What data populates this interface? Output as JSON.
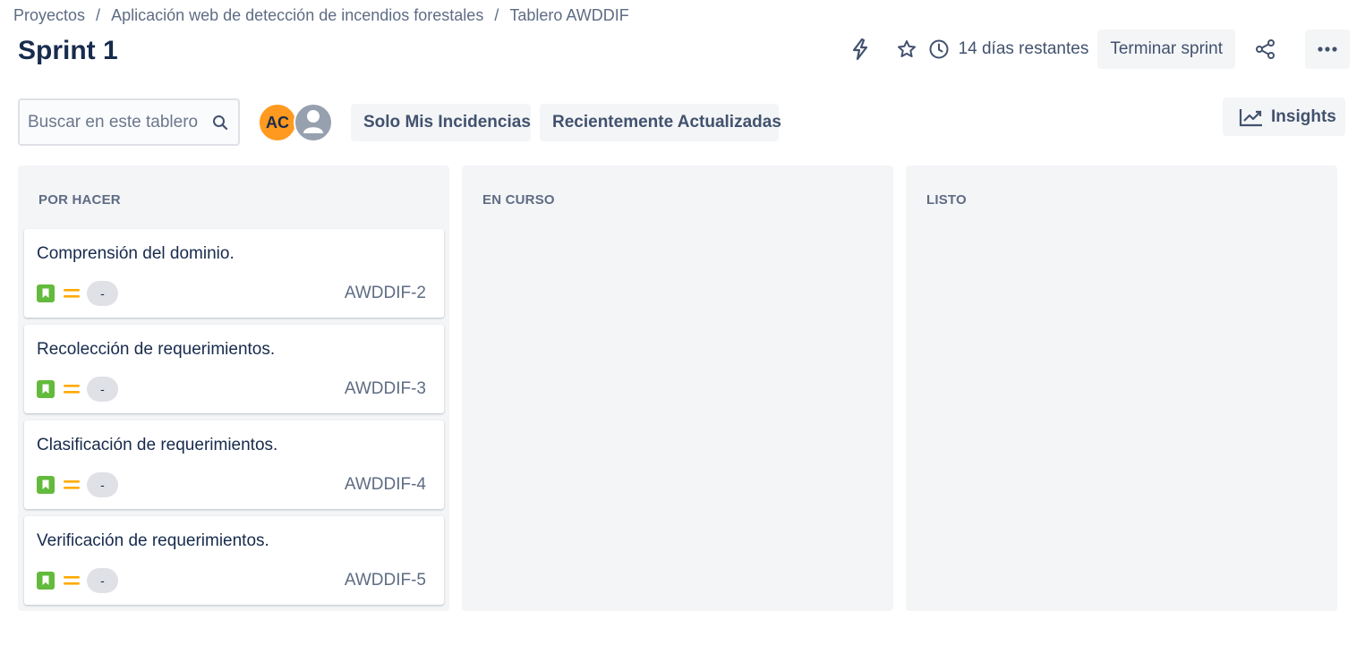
{
  "breadcrumb": [
    {
      "label": "Proyectos"
    },
    {
      "label": "Aplicación web de detección de incendios forestales"
    },
    {
      "label": "Tablero AWDDIF"
    }
  ],
  "breadcrumb_separator": "/",
  "title": "Sprint 1",
  "header": {
    "days_remaining": "14 días restantes",
    "complete_sprint_label": "Terminar sprint",
    "icons": [
      "automation-lightning-icon",
      "star-icon",
      "clock-icon",
      "share-icon",
      "more-icon"
    ]
  },
  "toolbar": {
    "search_placeholder": "Buscar en este tablero",
    "search_value": "",
    "avatars": [
      {
        "initials": "AC",
        "color": "#ff991f"
      },
      {
        "initials": "",
        "color": "#97a0af"
      }
    ],
    "filter_mine": "Solo Mis Incidencias",
    "filter_recent": "Recientemente Actualizadas",
    "insights_label": "Insights"
  },
  "columns": [
    {
      "name": "POR HACER",
      "cards": [
        {
          "title": "Comprensión del dominio.",
          "estimate": "-",
          "key": "AWDDIF-2"
        },
        {
          "title": "Recolección de requerimientos.",
          "estimate": "-",
          "key": "AWDDIF-3"
        },
        {
          "title": "Clasificación de requerimientos.",
          "estimate": "-",
          "key": "AWDDIF-4"
        },
        {
          "title": "Verificación de requerimientos.",
          "estimate": "-",
          "key": "AWDDIF-5"
        }
      ]
    },
    {
      "name": "EN CURSO",
      "cards": []
    },
    {
      "name": "LISTO",
      "cards": []
    }
  ],
  "colors": {
    "story": "#63ba3c",
    "priority_medium": "#ffab00",
    "column_bg": "#f4f5f7",
    "text_primary": "#172b4d",
    "text_secondary": "#5e6c84"
  }
}
